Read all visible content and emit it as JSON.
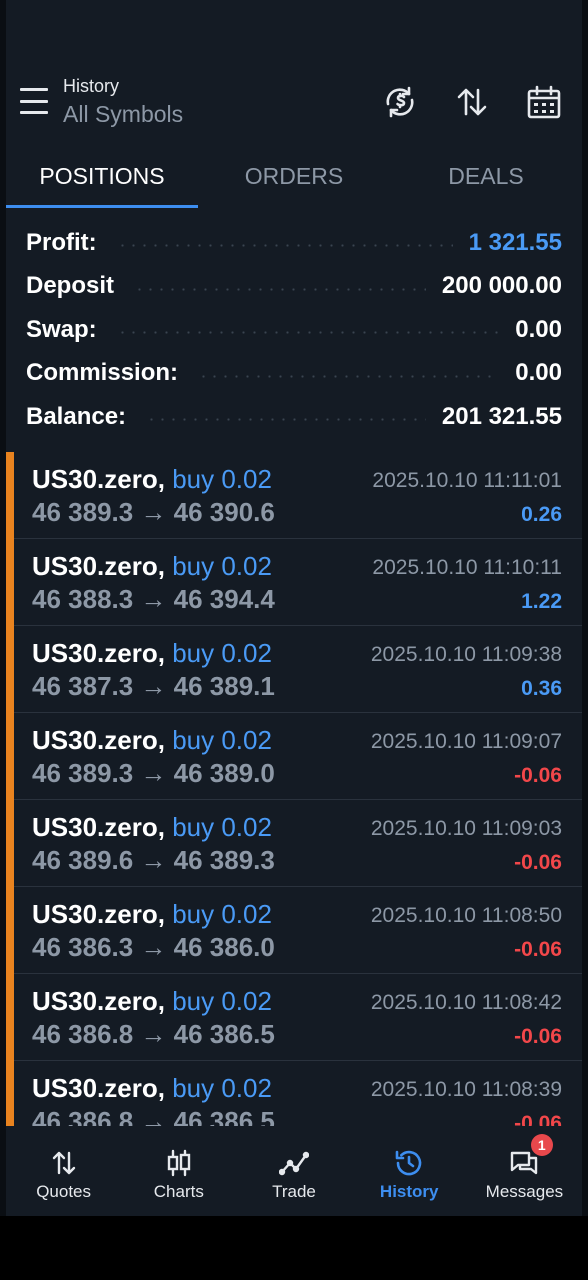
{
  "header": {
    "title": "History",
    "subtitle": "All Symbols",
    "icons": [
      "currency-sync-icon",
      "sort-icon",
      "calendar-icon"
    ]
  },
  "tabs": [
    {
      "label": "POSITIONS",
      "active": true
    },
    {
      "label": "ORDERS",
      "active": false
    },
    {
      "label": "DEALS",
      "active": false
    }
  ],
  "summary": {
    "profit_label": "Profit:",
    "profit_value": "1 321.55",
    "deposit_label": "Deposit",
    "deposit_value": "200 000.00",
    "swap_label": "Swap:",
    "swap_value": "0.00",
    "commission_label": "Commission:",
    "commission_value": "0.00",
    "balance_label": "Balance:",
    "balance_value": "201 321.55"
  },
  "positions": [
    {
      "symbol": "US30.zero,",
      "side": "buy 0.02",
      "prices": "46 389.3 → 46 390.6",
      "time": "2025.10.10 11:11:01",
      "pl": "0.26",
      "pl_sign": "pos"
    },
    {
      "symbol": "US30.zero,",
      "side": "buy 0.02",
      "prices": "46 388.3 → 46 394.4",
      "time": "2025.10.10 11:10:11",
      "pl": "1.22",
      "pl_sign": "pos"
    },
    {
      "symbol": "US30.zero,",
      "side": "buy 0.02",
      "prices": "46 387.3 → 46 389.1",
      "time": "2025.10.10 11:09:38",
      "pl": "0.36",
      "pl_sign": "pos"
    },
    {
      "symbol": "US30.zero,",
      "side": "buy 0.02",
      "prices": "46 389.3 → 46 389.0",
      "time": "2025.10.10 11:09:07",
      "pl": "-0.06",
      "pl_sign": "neg"
    },
    {
      "symbol": "US30.zero,",
      "side": "buy 0.02",
      "prices": "46 389.6 → 46 389.3",
      "time": "2025.10.10 11:09:03",
      "pl": "-0.06",
      "pl_sign": "neg"
    },
    {
      "symbol": "US30.zero,",
      "side": "buy 0.02",
      "prices": "46 386.3 → 46 386.0",
      "time": "2025.10.10 11:08:50",
      "pl": "-0.06",
      "pl_sign": "neg"
    },
    {
      "symbol": "US30.zero,",
      "side": "buy 0.02",
      "prices": "46 386.8 → 46 386.5",
      "time": "2025.10.10 11:08:42",
      "pl": "-0.06",
      "pl_sign": "neg"
    },
    {
      "symbol": "US30.zero,",
      "side": "buy 0.02",
      "prices": "46 386.8 → 46 386.5",
      "time": "2025.10.10 11:08:39",
      "pl": "-0.06",
      "pl_sign": "neg"
    }
  ],
  "bottom_nav": [
    {
      "label": "Quotes",
      "icon": "quotes-arrows-icon",
      "active": false
    },
    {
      "label": "Charts",
      "icon": "candlestick-icon",
      "active": false
    },
    {
      "label": "Trade",
      "icon": "trade-line-icon",
      "active": false
    },
    {
      "label": "History",
      "icon": "history-clock-icon",
      "active": true
    },
    {
      "label": "Messages",
      "icon": "messages-icon",
      "active": false,
      "badge": "1"
    }
  ],
  "colors": {
    "background": "#141b24",
    "accent": "#3d8ef0",
    "positive": "#4a9af5",
    "negative": "#f2474a",
    "position_marker": "#e8831f"
  }
}
